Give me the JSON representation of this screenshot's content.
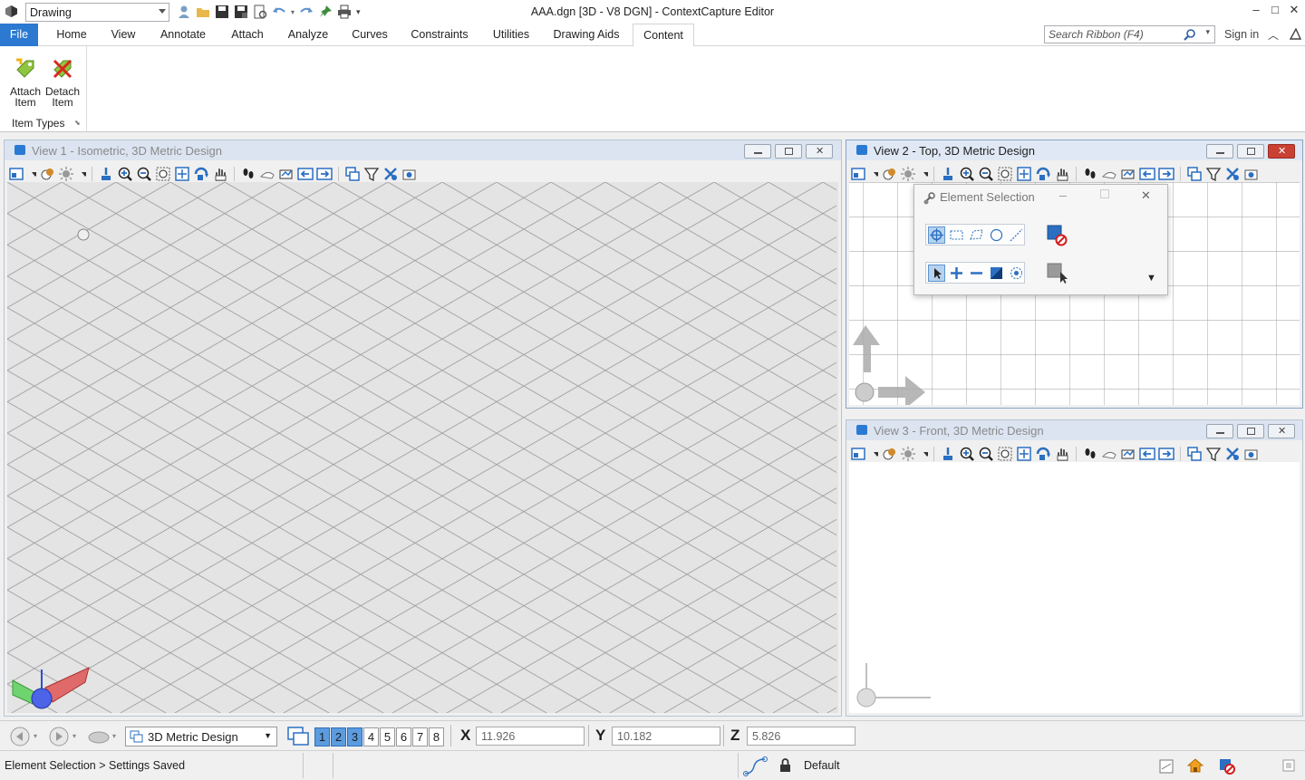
{
  "titlebar": {
    "workspace": "Drawing",
    "title": "AAA.dgn [3D - V8 DGN] - ContextCapture Editor"
  },
  "ribbon": {
    "tabs": [
      "File",
      "Home",
      "View",
      "Annotate",
      "Attach",
      "Analyze",
      "Curves",
      "Constraints",
      "Utilities",
      "Drawing Aids",
      "Content"
    ],
    "active_tab": "Content",
    "search_placeholder": "Search Ribbon (F4)",
    "sign_in": "Sign in",
    "buttons": [
      {
        "label_line1": "Attach",
        "label_line2": "Item",
        "icon": "attach-item-icon"
      },
      {
        "label_line1": "Detach",
        "label_line2": "Item",
        "icon": "detach-item-icon"
      }
    ],
    "group_label": "Item Types"
  },
  "views": {
    "view1": {
      "title": "View 1 - Isometric, 3D Metric Design"
    },
    "view2": {
      "title": "View 2 - Top, 3D Metric Design"
    },
    "view3": {
      "title": "View 3 - Front, 3D Metric Design"
    }
  },
  "element_selection": {
    "title": "Element Selection"
  },
  "bottombar": {
    "model": "3D Metric Design",
    "view_numbers": [
      "1",
      "2",
      "3",
      "4",
      "5",
      "6",
      "7",
      "8"
    ],
    "coords": {
      "x_label": "X",
      "x": "11.926",
      "y_label": "Y",
      "y": "10.182",
      "z_label": "Z",
      "z": "5.826"
    }
  },
  "status": {
    "message": "Element Selection > Settings Saved",
    "level": "Default"
  },
  "colors": {
    "accent": "#2b79d0",
    "grid_line": "#9a9a9a",
    "close_red": "#c94133"
  }
}
